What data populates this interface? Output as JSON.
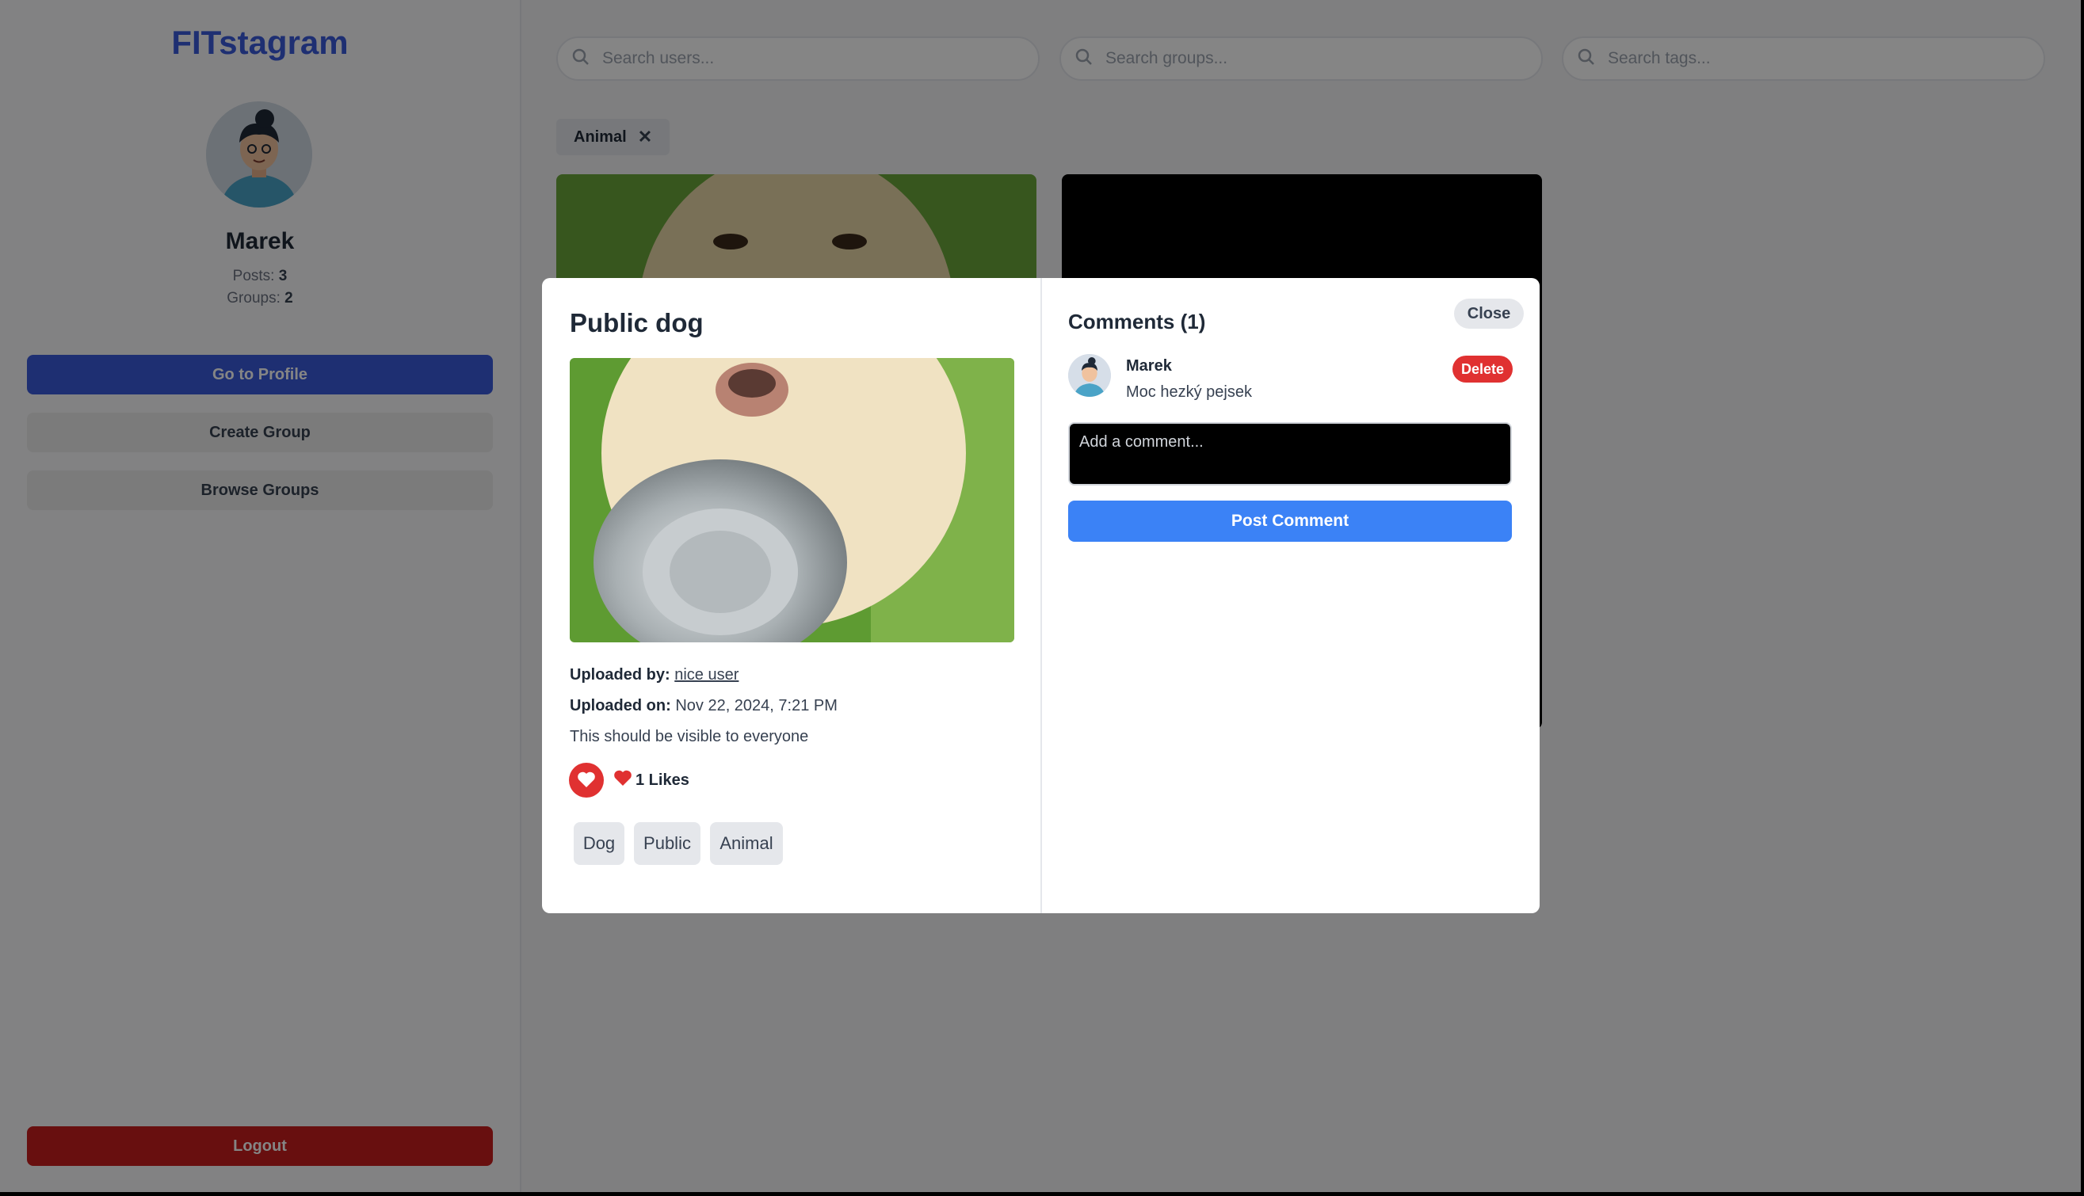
{
  "sidebar": {
    "brand": "FITstagram",
    "username": "Marek",
    "posts_label": "Posts:",
    "posts_count": "3",
    "groups_label": "Groups:",
    "groups_count": "2",
    "go_to_profile": "Go to Profile",
    "create_group": "Create Group",
    "browse_groups": "Browse Groups",
    "logout": "Logout"
  },
  "search": {
    "users_placeholder": "Search users...",
    "groups_placeholder": "Search groups...",
    "tags_placeholder": "Search tags..."
  },
  "active_filter": {
    "label": "Animal",
    "remove": "✕"
  },
  "modal": {
    "title": "Public dog",
    "uploaded_by_label": "Uploaded by:",
    "uploaded_by_value": "nice user",
    "uploaded_on_label": "Uploaded on:",
    "uploaded_on_value": "Nov 22, 2024, 7:21 PM",
    "description": "This should be visible to everyone",
    "likes_text": "1 Likes",
    "tags": [
      "Dog",
      "Public",
      "Animal"
    ],
    "comments_title": "Comments (1)",
    "close": "Close",
    "comment": {
      "user": "Marek",
      "text": "Moc hezký pejsek",
      "delete": "Delete"
    },
    "comment_placeholder": "Add a comment...",
    "post_comment": "Post Comment"
  },
  "colors": {
    "brand": "#3b5bdb",
    "like": "#e03131",
    "post_button": "#3b82f6",
    "logout": "#c81e1e"
  }
}
